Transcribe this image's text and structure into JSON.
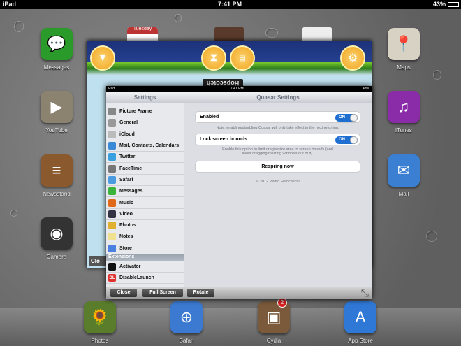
{
  "status": {
    "device": "iPad",
    "time": "7:41 PM",
    "battery": "43%"
  },
  "home_left": [
    {
      "label": "Messages",
      "color": "#2a9a2a"
    },
    {
      "label": "YouTube",
      "color": "#8b8270"
    },
    {
      "label": "Newsstand",
      "color": "#8a5a2e"
    },
    {
      "label": "Camera",
      "color": "#333"
    }
  ],
  "home_right": [
    {
      "label": "Maps",
      "color": "#d8d2c4"
    },
    {
      "label": "iTunes",
      "color": "#8a2ca8"
    },
    {
      "label": "Mail",
      "color": "#3a7fd1"
    }
  ],
  "home_top": {
    "calendar_day": "Tuesday"
  },
  "dock": [
    {
      "label": "Photos",
      "color": "#5a7d2c"
    },
    {
      "label": "Safari",
      "color": "#3b7ad0"
    },
    {
      "label": "Cydia",
      "color": "#7a5a3a",
      "badge": "2"
    },
    {
      "label": "App Store",
      "color": "#2f78d6"
    }
  ],
  "game": {
    "close_label": "Clo",
    "top_text": "Hopscotch"
  },
  "quasar": {
    "status": {
      "device": "iPad",
      "time": "7:41 PM",
      "battery": "43%"
    },
    "left_title": "Settings",
    "right_title": "Quasar Settings",
    "settings_items": [
      {
        "label": "Picture Frame",
        "color": "#888"
      },
      {
        "label": "General",
        "color": "#999"
      },
      {
        "label": "iCloud",
        "color": "#bbb"
      },
      {
        "label": "Mail, Contacts, Calendars",
        "color": "#3a8ad8"
      },
      {
        "label": "Twitter",
        "color": "#3aa0e0"
      },
      {
        "label": "FaceTime",
        "color": "#777"
      },
      {
        "label": "Safari",
        "color": "#4a9be0"
      },
      {
        "label": "Messages",
        "color": "#3cb43c"
      },
      {
        "label": "Music",
        "color": "#e06a1a"
      },
      {
        "label": "Video",
        "color": "#334"
      },
      {
        "label": "Photos",
        "color": "#e0b030"
      },
      {
        "label": "Notes",
        "color": "#f0e090"
      },
      {
        "label": "Store",
        "color": "#4a80e0"
      }
    ],
    "extensions_header": "Extensions",
    "extensions": [
      {
        "label": "Activator",
        "color": "#111"
      },
      {
        "label": "DisableLaunch",
        "color": "#e03030",
        "glyph": "DL"
      }
    ],
    "enabled_label": "Enabled",
    "enabled_value": "ON",
    "enabled_note": "Note: enabling/disabling Quasar will only take effect in the next respring.",
    "lock_label": "Lock screen bounds",
    "lock_value": "ON",
    "lock_note": "Enable this option to limit drag/resize area to screen bounds (and avoid dragging/resizing windows out of it).",
    "respring_label": "Respring now",
    "copyright": "© 2012 Pedro Franceschi",
    "toolbar": {
      "close": "Close",
      "fullscreen": "Full Screen",
      "rotate": "Rotate"
    }
  }
}
